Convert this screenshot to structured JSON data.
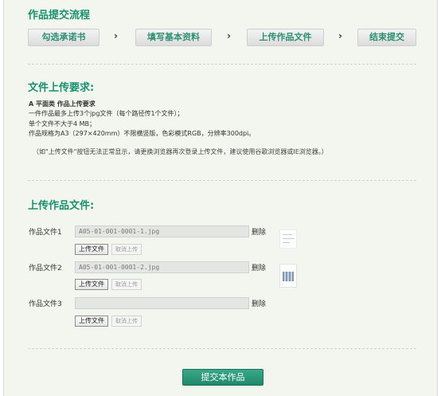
{
  "flow": {
    "title": "作品提交流程",
    "steps": [
      "勾选承诺书",
      "填写基本资料",
      "上传作品文件",
      "结束提交"
    ],
    "arrow": "›"
  },
  "requirements": {
    "heading": "文件上传要求:",
    "subtitle": "A 平面类 作品上传要求",
    "lines": [
      "一件作品最多上传3个jpg文件（每个路径传1个文件）；",
      "单个文件不大于4 MB；",
      "作品规格为A3（297×420mm）不限横竖版，色彩模式RGB，分辨率300dpi。"
    ],
    "note": "（如\"上传文件\"按钮无法正常显示，请更换浏览器再次登录上传文件，建议使用谷歌浏览器或IE浏览器。）"
  },
  "upload": {
    "heading": "上传作品文件:",
    "files": [
      {
        "label": "作品文件1",
        "value": "A05-01-001-0001-1.jpg"
      },
      {
        "label": "作品文件2",
        "value": "A05-01-001-0001-2.jpg"
      },
      {
        "label": "作品文件3",
        "value": ""
      }
    ],
    "delete_label": "删除",
    "upload_button": "上传文件",
    "cancel_button": "取消上传"
  },
  "submit_label": "提交本作品",
  "colors": {
    "accent": "#18926e",
    "background": "#f3f6ef",
    "submit": "#2a9a7b"
  }
}
